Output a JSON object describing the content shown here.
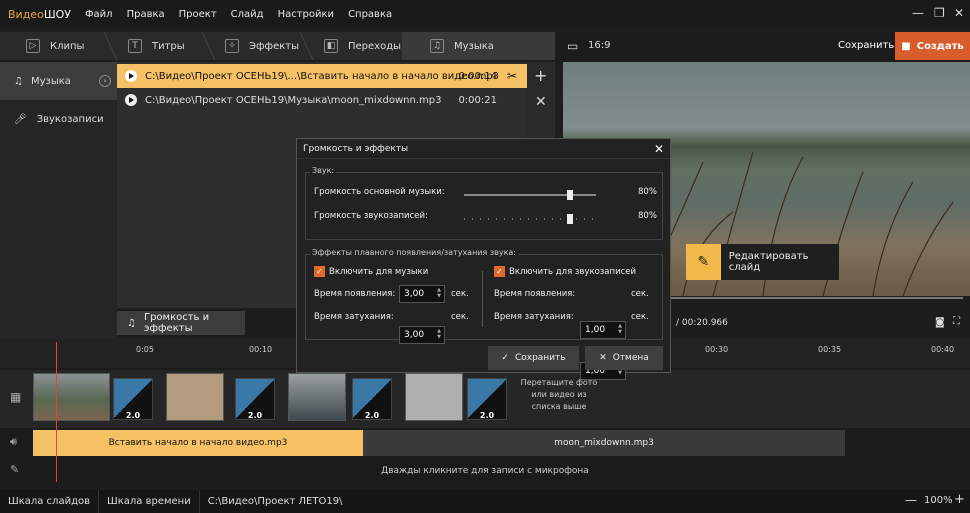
{
  "app": {
    "title_a": "Видео",
    "title_b": "ШОУ"
  },
  "menu": [
    "Файл",
    "Правка",
    "Проект",
    "Слайд",
    "Настройки",
    "Справка"
  ],
  "tabs": [
    "Клипы",
    "Титры",
    "Эффекты",
    "Переходы",
    "Музыка"
  ],
  "sidebar": [
    "Музыка",
    "Звукозаписи"
  ],
  "files": [
    {
      "path": "C:\\Видео\\Проект ОСЕНЬ19\\...\\Вставить начало в начало видео.mp3",
      "dur": "0:00:14"
    },
    {
      "path": "C:\\Видео\\Проект ОСЕНЬ19\\Музыка\\moon_mixdownn.mp3",
      "dur": "0:00:21"
    }
  ],
  "volume_button": "Громкость и эффекты",
  "preview": {
    "ratio": "16:9",
    "save": "Сохранить",
    "create": "Создать",
    "edit_slide": "Редактировать слайд",
    "time": "/ 00:20.966"
  },
  "ruler": [
    "0:05",
    "00:10",
    "00:30",
    "00:35",
    "00:40"
  ],
  "clips": {
    "trans": [
      "2.0",
      "2.0",
      "2.0",
      "2.0"
    ],
    "hint": "Перетащите фото или видео из списка выше"
  },
  "audio": {
    "clip1": "Вставить начало в начало видео.mp3",
    "clip2": "moon_mixdownn.mp3",
    "mic_hint": "Дважды кликните для записи с микрофона"
  },
  "status": {
    "slides": "Шкала слайдов",
    "time": "Шкала времени",
    "path": "C:\\Видео\\Проект ЛЕТО19\\",
    "zoom": "100%"
  },
  "dialog": {
    "title": "Громкость и эффекты",
    "sound_legend": "Звук:",
    "main_music": "Громкость основной музыки:",
    "main_music_val": "80%",
    "main_music_level": 0.8,
    "records": "Громкость звукозаписей:",
    "records_val": "80%",
    "records_level": 0.8,
    "fade_legend": "Эффекты плавного появления/затухания звука:",
    "music_chk": "Включить для музыки",
    "rec_chk": "Включить для звукозаписей",
    "appear": "Время появления:",
    "fade": "Время затухания:",
    "m_appear": "3,00",
    "m_fade": "3,00",
    "r_appear": "1,00",
    "r_fade": "1,00",
    "sec": "сек.",
    "save": "Сохранить",
    "cancel": "Отмена"
  },
  "colors": {
    "accent": "#f6c164",
    "create": "#d85c2c",
    "check": "#e06a2e"
  }
}
